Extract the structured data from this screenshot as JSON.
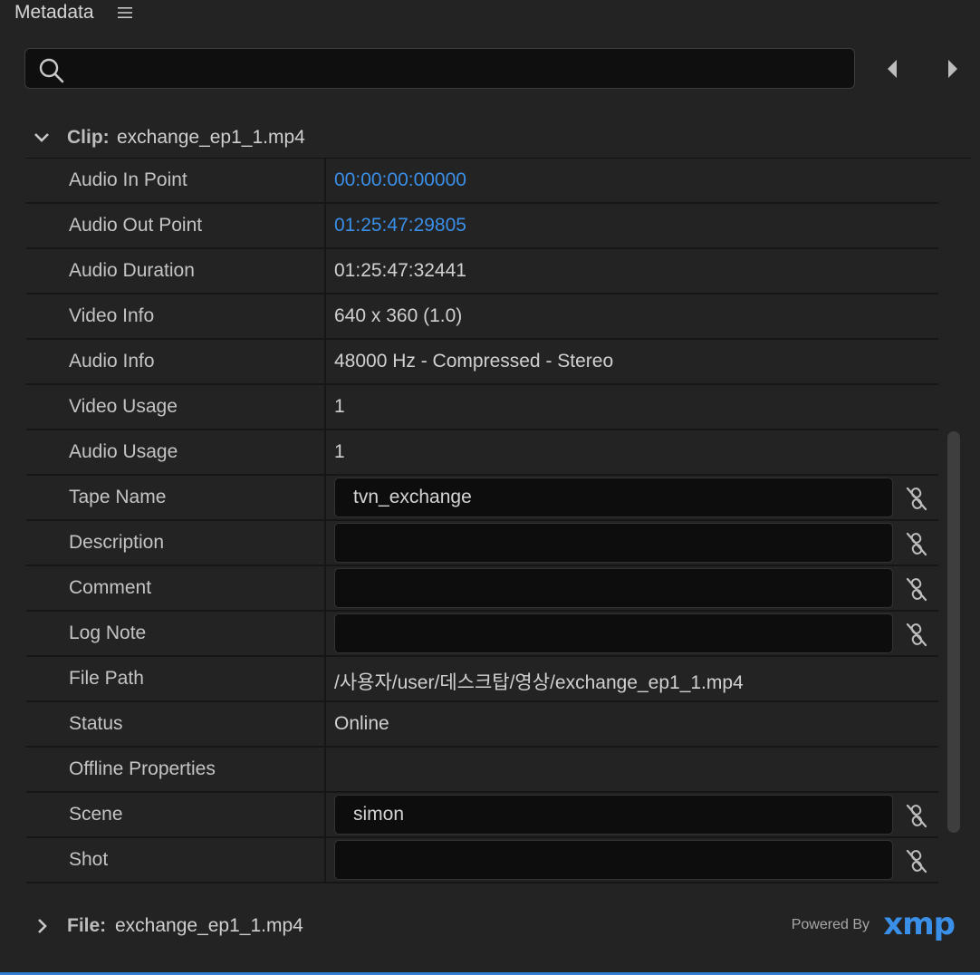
{
  "panel": {
    "title": "Metadata"
  },
  "search": {
    "value": "",
    "placeholder": ""
  },
  "clip_section": {
    "label": "Clip:",
    "value": "exchange_ep1_1.mp4"
  },
  "rows": [
    {
      "key": "Audio In Point",
      "value": "00:00:00:00000",
      "type": "link"
    },
    {
      "key": "Audio Out Point",
      "value": "01:25:47:29805",
      "type": "link"
    },
    {
      "key": "Audio Duration",
      "value": "01:25:47:32441",
      "type": "text"
    },
    {
      "key": "Video Info",
      "value": "640 x 360 (1.0)",
      "type": "text"
    },
    {
      "key": "Audio Info",
      "value": "48000 Hz - Compressed - Stereo",
      "type": "text"
    },
    {
      "key": "Video Usage",
      "value": "1",
      "type": "text"
    },
    {
      "key": "Audio Usage",
      "value": "1",
      "type": "text"
    },
    {
      "key": "Tape Name",
      "value": "tvn_exchange",
      "type": "input"
    },
    {
      "key": "Description",
      "value": "",
      "type": "input"
    },
    {
      "key": "Comment",
      "value": "",
      "type": "input"
    },
    {
      "key": "Log Note",
      "value": "",
      "type": "input"
    },
    {
      "key": "File Path",
      "value": "/사용자/user/데스크탑/영상/exchange_ep1_1.mp4",
      "type": "text"
    },
    {
      "key": "Status",
      "value": "Online",
      "type": "text"
    },
    {
      "key": "Offline Properties",
      "value": "",
      "type": "text"
    },
    {
      "key": "Scene",
      "value": "simon",
      "type": "input"
    },
    {
      "key": "Shot",
      "value": "",
      "type": "input"
    }
  ],
  "file_section": {
    "label": "File:",
    "value": "exchange_ep1_1.mp4"
  },
  "footer": {
    "powered_by": "Powered By",
    "brand": "xmp"
  },
  "colors": {
    "accent": "#3a8fe8",
    "background": "#232323",
    "field": "#0d0d0d"
  },
  "icons": [
    "menu-icon",
    "search-icon",
    "chevron-left-icon",
    "chevron-right-icon",
    "chevron-down-icon",
    "chevron-right-icon",
    "unlink-icon"
  ]
}
